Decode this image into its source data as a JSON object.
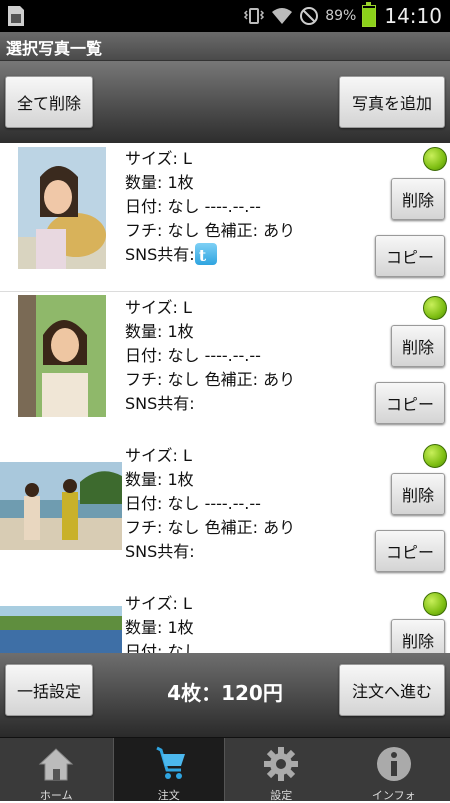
{
  "status_bar": {
    "battery_percent": "89%",
    "battery_level": 0.89,
    "time": "14:10"
  },
  "title": "選択写真一覧",
  "actions": {
    "delete_all": "全て削除",
    "add_photo": "写真を追加"
  },
  "field_labels": {
    "size": "サイズ: ",
    "quantity": "数量: ",
    "date": "日付: ",
    "border": "フチ: ",
    "color_correction": "色補正: ",
    "sns": "SNS共有:"
  },
  "items": [
    {
      "size": "L",
      "quantity": "1枚",
      "date": "なし ----.--.--",
      "border": "なし",
      "color_correction": "あり",
      "sns_twitter": true,
      "delete_label": "削除",
      "copy_label": "コピー"
    },
    {
      "size": "L",
      "quantity": "1枚",
      "date": "なし ----.--.--",
      "border": "なし",
      "color_correction": "あり",
      "sns_twitter": false,
      "delete_label": "削除",
      "copy_label": "コピー"
    },
    {
      "size": "L",
      "quantity": "1枚",
      "date": "なし ----.--.--",
      "border": "なし",
      "color_correction": "あり",
      "sns_twitter": false,
      "delete_label": "削除",
      "copy_label": "コピー"
    },
    {
      "size": "L",
      "quantity": "1枚",
      "date": "なし",
      "delete_label": "削除"
    }
  ],
  "twitter_icon": "t",
  "bottom": {
    "bulk_settings": "一括設定",
    "total": "4枚：120円",
    "proceed": "注文へ進む"
  },
  "tabs": [
    {
      "label": "ホーム",
      "icon": "home-icon"
    },
    {
      "label": "注文",
      "icon": "cart-icon",
      "active": true
    },
    {
      "label": "設定",
      "icon": "gear-icon"
    },
    {
      "label": "インフォ",
      "icon": "info-icon"
    }
  ],
  "colors": {
    "status_green": "#8bd11a",
    "cart_blue": "#2fa4e0",
    "twitter_blue": "#2fa4e0"
  }
}
